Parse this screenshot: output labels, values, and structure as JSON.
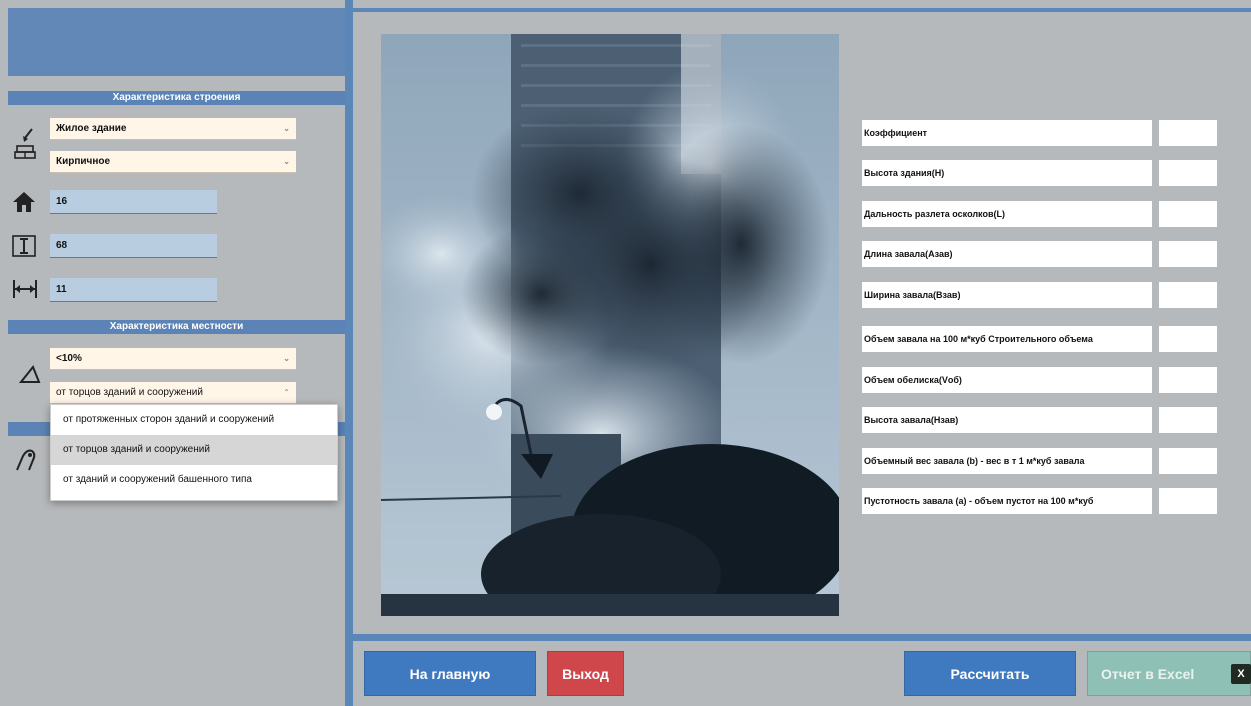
{
  "building_section": {
    "header": "Характеристика строения",
    "building_type": "Жилое здание",
    "material": "Кирпичное",
    "floors": "16",
    "height": "68",
    "width": "11"
  },
  "terrain_section": {
    "header": "Характеристика местности",
    "slope": "<10%",
    "direction": "от торцов зданий и сооружений"
  },
  "dropdown": {
    "options": [
      "от протяженных сторон зданий и сооружений",
      "от торцов зданий и сооружений",
      "от зданий и сооружений башенного типа"
    ],
    "selected_index": 1
  },
  "results": [
    {
      "label": "Коэффициент",
      "value": ""
    },
    {
      "label": "Высота здания(Н)",
      "value": ""
    },
    {
      "label": "Дальность разлета осколков(L)",
      "value": ""
    },
    {
      "label": "Длина завала(Азав)",
      "value": ""
    },
    {
      "label": "Ширина завала(Взав)",
      "value": ""
    },
    {
      "label": "Объем завала на 100 м*куб Строительного объема",
      "value": ""
    },
    {
      "label": "Объем обелиска(Vоб)",
      "value": ""
    },
    {
      "label": "Высота завала(Нзав)",
      "value": ""
    },
    {
      "label": "Объемный вес завала (b) - вес в т 1 м*куб завала",
      "value": ""
    },
    {
      "label": "Пустотность завала (a) - объем пустот на 100 м*куб",
      "value": ""
    }
  ],
  "buttons": {
    "home": "На главную",
    "exit": "Выход",
    "calculate": "Рассчитать",
    "excel": "Отчет в Excel",
    "excel_icon_letter": "X"
  },
  "colors": {
    "accent": "#5b86b8",
    "button_primary": "#3f79c0",
    "button_danger": "#d0474b",
    "button_disabled": "#8fc0b6"
  },
  "icons": {
    "building_type": "brick-trowel-icon",
    "floors": "house-icon",
    "height": "height-icon",
    "width": "width-icon",
    "slope": "triangle-icon",
    "terrain_extra": "tool-icon"
  }
}
